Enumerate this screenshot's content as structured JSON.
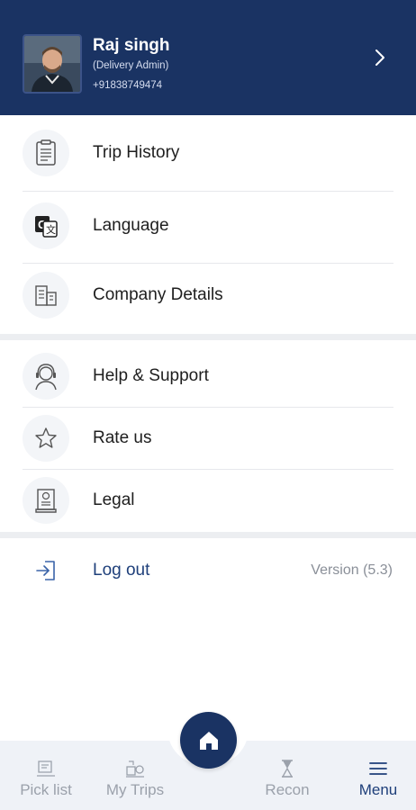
{
  "profile": {
    "name": "Raj singh",
    "role": "(Delivery Admin)",
    "phone": "+91838749474"
  },
  "menu": {
    "section1": [
      {
        "label": "Trip History",
        "icon": "clipboard-icon"
      },
      {
        "label": "Language",
        "icon": "translate-icon"
      },
      {
        "label": "Company Details",
        "icon": "building-icon"
      }
    ],
    "section2": [
      {
        "label": "Help & Support",
        "icon": "support-agent-icon"
      },
      {
        "label": "Rate us",
        "icon": "star-icon"
      },
      {
        "label": "Legal",
        "icon": "certificate-icon"
      }
    ],
    "logout_label": "Log out",
    "version": "Version (5.3)"
  },
  "bottom_nav": {
    "items": [
      {
        "label": "Pick list",
        "icon": "pick-list-icon"
      },
      {
        "label": "My Trips",
        "icon": "trips-icon"
      },
      {
        "label": "Recon",
        "icon": "hourglass-icon"
      },
      {
        "label": "Menu",
        "icon": "hamburger-icon"
      }
    ],
    "home_icon": "home-icon",
    "active": "Menu"
  },
  "colors": {
    "header_bg": "#1a3363",
    "accent": "#1e3f7a",
    "inactive": "#9ba1ab"
  }
}
